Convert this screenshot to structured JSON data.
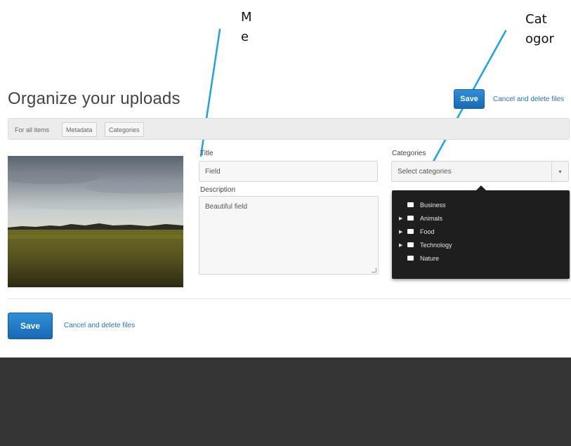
{
  "annotations": {
    "metadata_callout": "M\ne",
    "categories_callout": "Cat\nogor"
  },
  "page_title": "Organize your uploads",
  "actions": {
    "save_label": "Save",
    "cancel_label_top": "Cancel and delete files",
    "cancel_label_bottom": "Cancel and delete files"
  },
  "tabs": [
    {
      "label": "For all items"
    },
    {
      "label": "Metadata"
    },
    {
      "label": "Categories"
    }
  ],
  "form": {
    "title_label": "Title",
    "title_value": "Field",
    "description_label": "Description",
    "description_value": "Beautiful field",
    "categories_label": "Categories",
    "categories_placeholder": "Select categories"
  },
  "categories": [
    {
      "label": "Business",
      "has_children": false
    },
    {
      "label": "Animals",
      "has_children": true
    },
    {
      "label": "Food",
      "has_children": true
    },
    {
      "label": "Technology",
      "has_children": true
    },
    {
      "label": "Nature",
      "has_children": false
    }
  ],
  "colors": {
    "accent": "#1f77c8",
    "link": "#2b72c2",
    "dropdown_bg": "#1e1e1e",
    "footer_bg": "#353535"
  },
  "icons": {
    "caret": "chevron-down-icon",
    "expand": "triangle-right-icon"
  }
}
